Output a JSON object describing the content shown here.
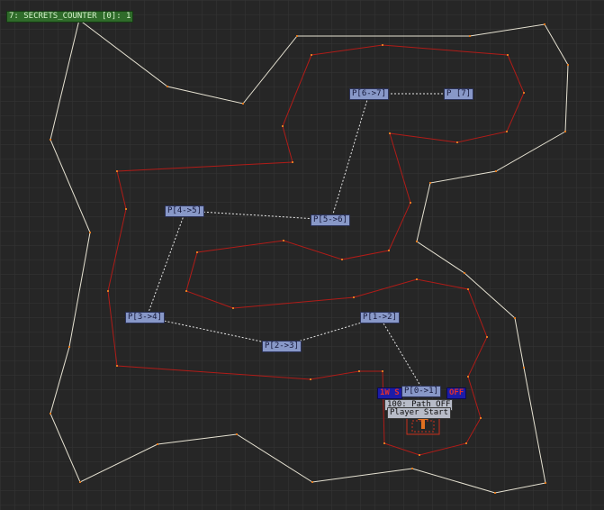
{
  "sector_tag": "7: SECRETS_COUNTER [0]: 1",
  "path_labels": [
    "P[6->7]",
    "P [7]",
    "P[4->5]",
    "P[5->6]",
    "P[3->4]",
    "P[1->2]",
    "P[2->3]",
    "P[0->1]"
  ],
  "switch_tag": "1W S",
  "switch_tag_end": "OFF",
  "path_toggle_label": "100: Path OFF",
  "player_start_label": "Player Start",
  "colors": {
    "background": "#262626",
    "grid": "#353535",
    "outer_wall": "#e6e2d2",
    "inner_wall": "#b01c18",
    "path_line": "#e8e8e8",
    "player_start": "#e07020"
  },
  "icons": [
    "player-start-arrow-icon"
  ]
}
